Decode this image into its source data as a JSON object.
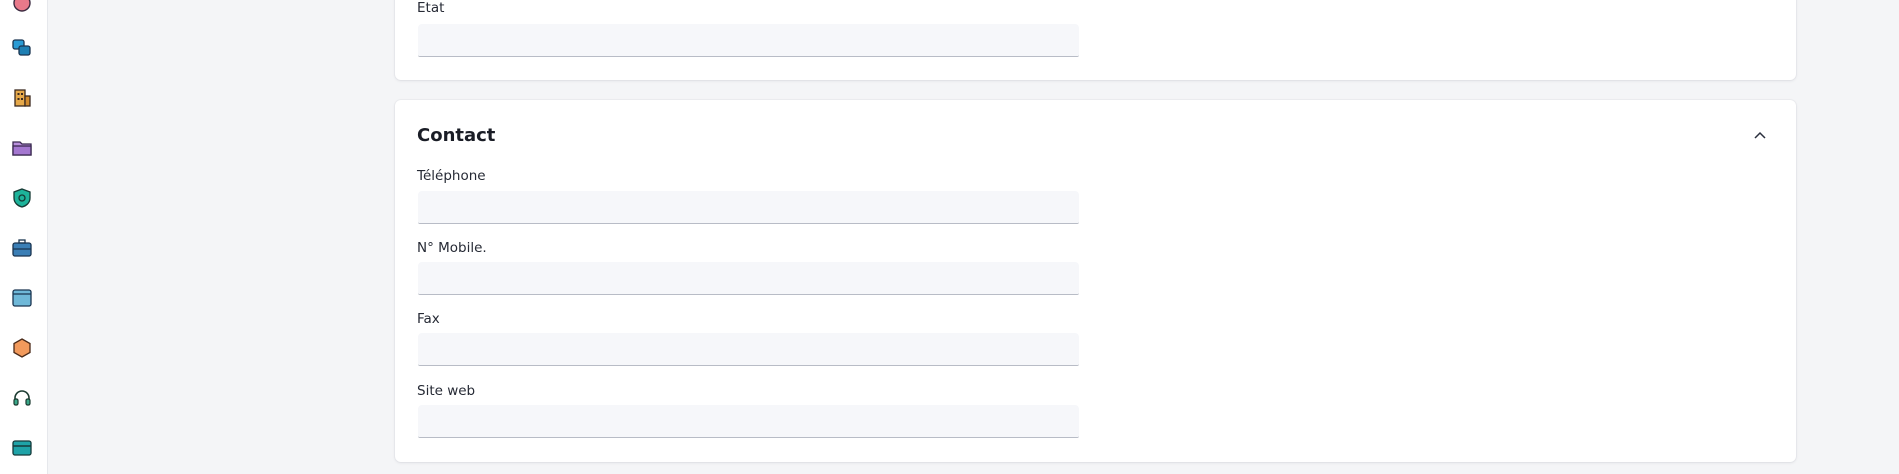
{
  "sidebar": {
    "icons": [
      "partial-top-icon",
      "messages-icon",
      "building-icon",
      "folder-icon",
      "shield-icon",
      "briefcase-icon",
      "window-icon",
      "hexagon-icon",
      "headset-icon",
      "card-icon"
    ]
  },
  "address_section": {
    "state_label": "Etat",
    "state_value": ""
  },
  "contact_section": {
    "title": "Contact",
    "collapse_icon": "chevron-up-icon",
    "phone_label": "Téléphone",
    "phone_value": "",
    "mobile_label": "N° Mobile.",
    "mobile_value": "",
    "fax_label": "Fax",
    "fax_value": "",
    "website_label": "Site web",
    "website_value": ""
  }
}
